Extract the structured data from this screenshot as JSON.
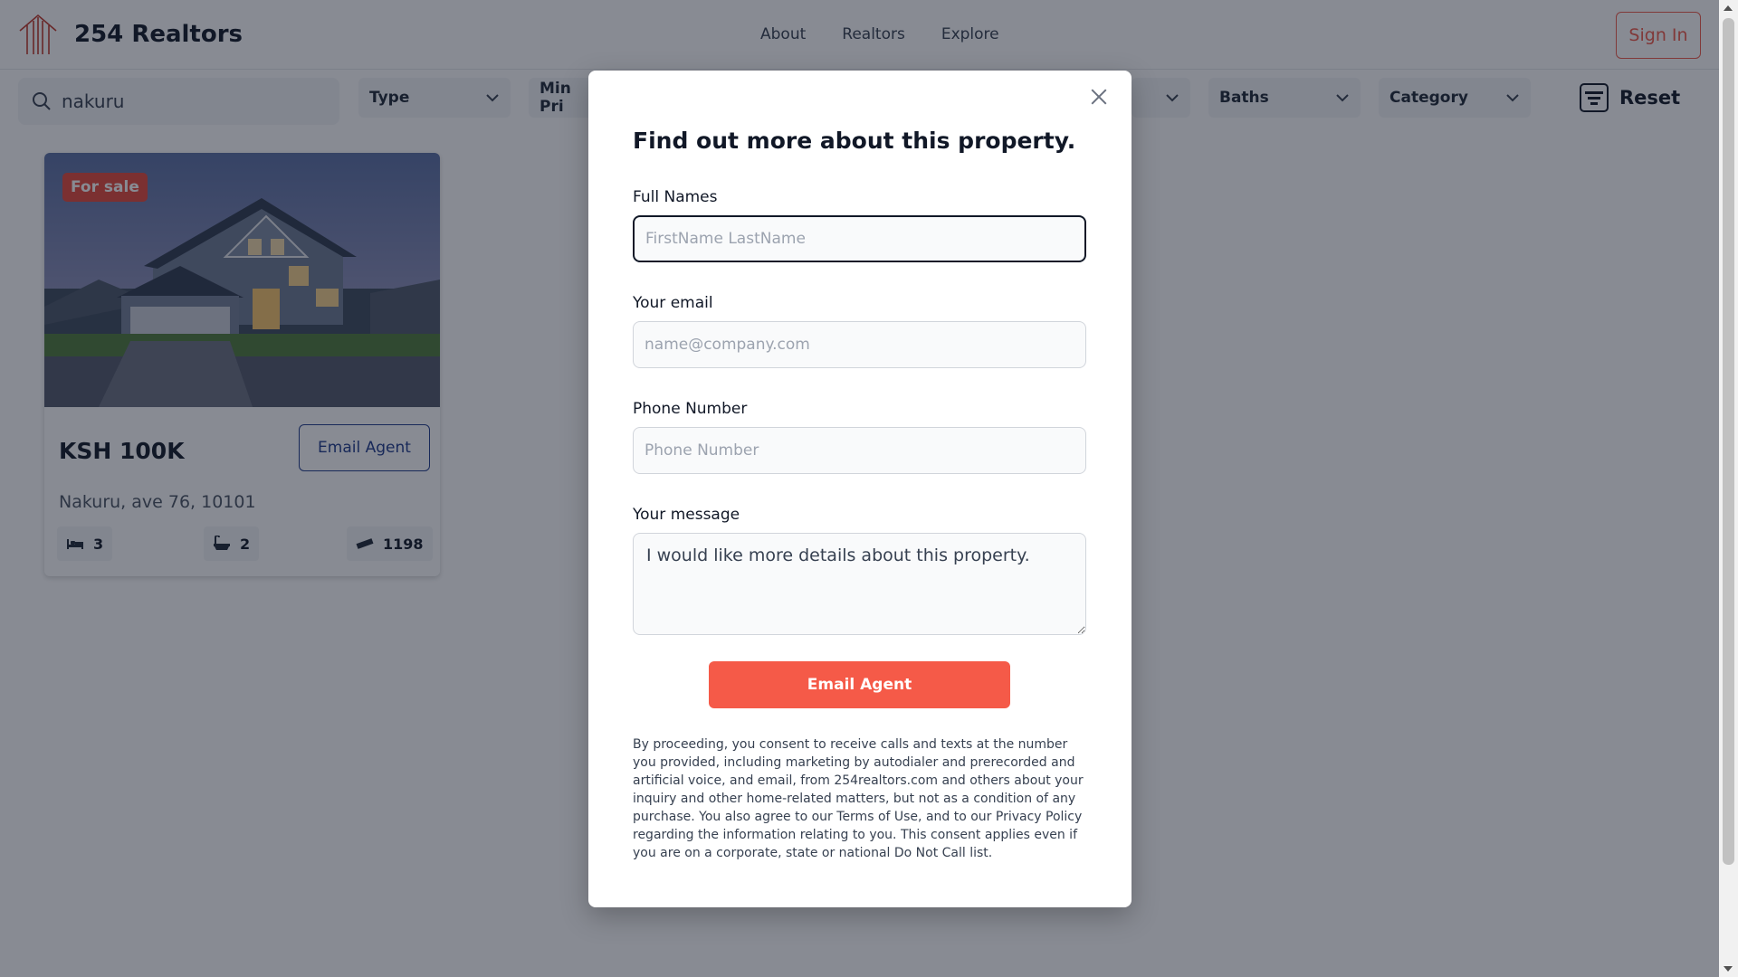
{
  "brand": {
    "name": "254 Realtors",
    "logo_icon": "house-lines-logo"
  },
  "nav": {
    "links": [
      "About",
      "Realtors",
      "Explore"
    ],
    "signin_label": "Sign In"
  },
  "filters": {
    "search_value": "nakuru",
    "type_label": "Type",
    "min_price_label": "Min Pri",
    "baths_label": "Baths",
    "category_label": "Category",
    "reset_label": "Reset"
  },
  "listing": {
    "badge": "For sale",
    "price": "KSH 100K",
    "email_agent_label": "Email Agent",
    "address": "Nakuru, ave 76, 10101",
    "beds": "3",
    "baths": "2",
    "area": "1198"
  },
  "modal": {
    "title": "Find out more about this property.",
    "full_names_label": "Full Names",
    "full_names_placeholder": "FirstName LastName",
    "email_label": "Your email",
    "email_placeholder": "name@company.com",
    "phone_label": "Phone Number",
    "phone_placeholder": "Phone Number",
    "message_label": "Your message",
    "message_value": "I would like more details about this property.",
    "submit_label": "Email Agent",
    "consent_text": "By proceeding, you consent to receive calls and texts at the number you provided, including marketing by autodialer and prerecorded and artificial voice, and email, from 254realtors.com and others about your inquiry and other home-related matters, but not as a condition of any purchase. You also agree to our Terms of Use, and to our Privacy Policy regarding the information relating to you. This consent applies even if you are on a corporate, state or national Do Not Call list."
  },
  "colors": {
    "accent": "#f55a48",
    "brand_blue": "#1e3a8a",
    "overlay": "rgba(17,24,39,0.5)"
  }
}
